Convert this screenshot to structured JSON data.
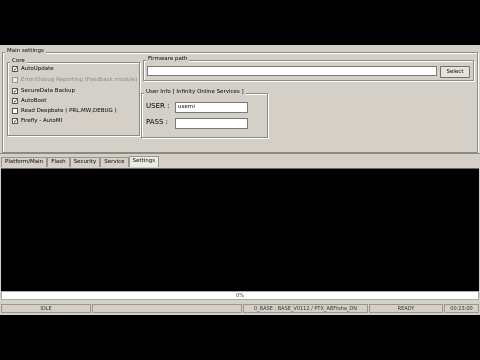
{
  "main_settings": {
    "legend": "Main settings",
    "core": {
      "legend": "Core",
      "options": [
        {
          "label": "AutoUpdate",
          "checked": true,
          "disabled": false
        },
        {
          "label": "Error/Debug Reporting (Feedback module)",
          "checked": false,
          "disabled": true
        },
        {
          "label": "SecureData Backup",
          "checked": true,
          "disabled": false
        },
        {
          "label": "AutoBoot",
          "checked": true,
          "disabled": false
        },
        {
          "label": "Read Deepbate ( PRL,MW,DEBUG )",
          "checked": false,
          "disabled": false
        },
        {
          "label": "Firefly - AutoMI",
          "checked": true,
          "disabled": false
        }
      ]
    },
    "firmware": {
      "legend": "Firmware path",
      "value": "",
      "select_label": "Select"
    },
    "user_info": {
      "legend": "User Info  [ Infinity Online Services ]",
      "user_label": "USER :",
      "user_value": "userni",
      "pass_label": "PASS :",
      "pass_value": ""
    }
  },
  "tabs": [
    {
      "label": "Platform/Main",
      "active": false
    },
    {
      "label": "Flash",
      "active": false
    },
    {
      "label": "Security",
      "active": false
    },
    {
      "label": "Service",
      "active": false
    },
    {
      "label": "Settings",
      "active": true
    }
  ],
  "progress": {
    "text": "0%",
    "value": 0
  },
  "statusbar": {
    "left": "IDLE",
    "middle": "0_BASE : BASE_V0112 / PTX_ABFtsha_DN",
    "state": "READY",
    "time": "00:23:00"
  },
  "colors": {
    "window": "#d4d0c8",
    "console": "#000000",
    "frame": "#000000"
  }
}
